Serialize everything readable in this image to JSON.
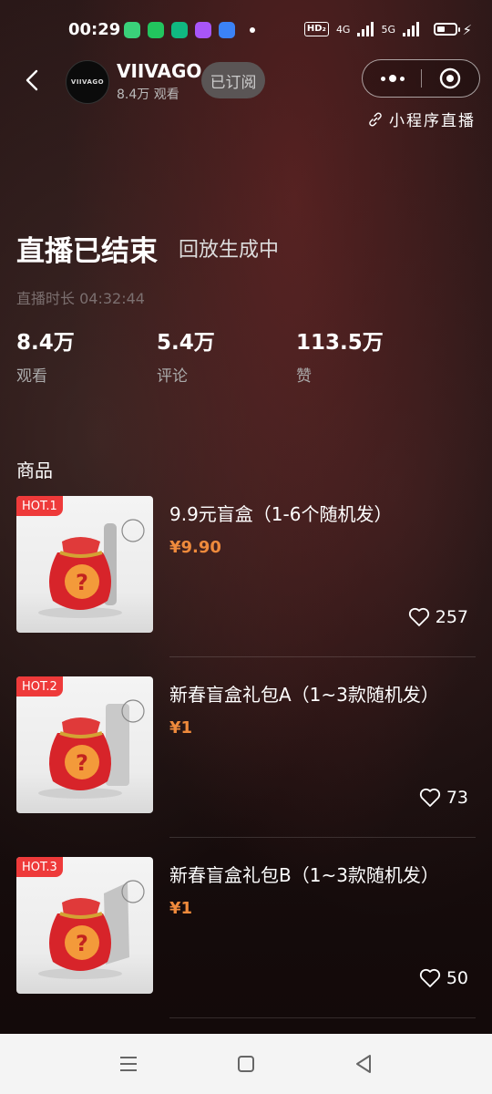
{
  "status_bar": {
    "time": "00:29",
    "network_badge": "HD₂",
    "net_1": "4G",
    "net_2": "5G",
    "app_icon_colors": [
      "#3ad17a",
      "#22c55e",
      "#10b981",
      "#a855f7",
      "#3b82f6"
    ]
  },
  "header": {
    "shop_name": "VIIVAGO",
    "avatar_text": "VIIVAGO",
    "views": "8.4万 观看",
    "subscribed_label": "已订阅",
    "mini_program_live": "小程序直播"
  },
  "live": {
    "ended_title": "直播已结束",
    "replay_status": "回放生成中",
    "duration": "直播时长 04:32:44",
    "stats": [
      {
        "value": "8.4万",
        "label": "观看"
      },
      {
        "value": "5.4万",
        "label": "评论"
      },
      {
        "value": "113.5万",
        "label": "赞"
      }
    ]
  },
  "products_section": {
    "title": "商品",
    "items": [
      {
        "hot": "HOT.1",
        "name": "9.9元盲盒（1-6个随机发）",
        "price": "¥9.90",
        "likes": "257"
      },
      {
        "hot": "HOT.2",
        "name": "新春盲盒礼包A（1~3款随机发）",
        "price": "¥1",
        "likes": "73"
      },
      {
        "hot": "HOT.3",
        "name": "新春盲盒礼包B（1~3款随机发）",
        "price": "¥1",
        "likes": "50"
      }
    ]
  },
  "colors": {
    "accent_price": "#ef8a3c",
    "hot_badge": "#ee3a3a"
  }
}
